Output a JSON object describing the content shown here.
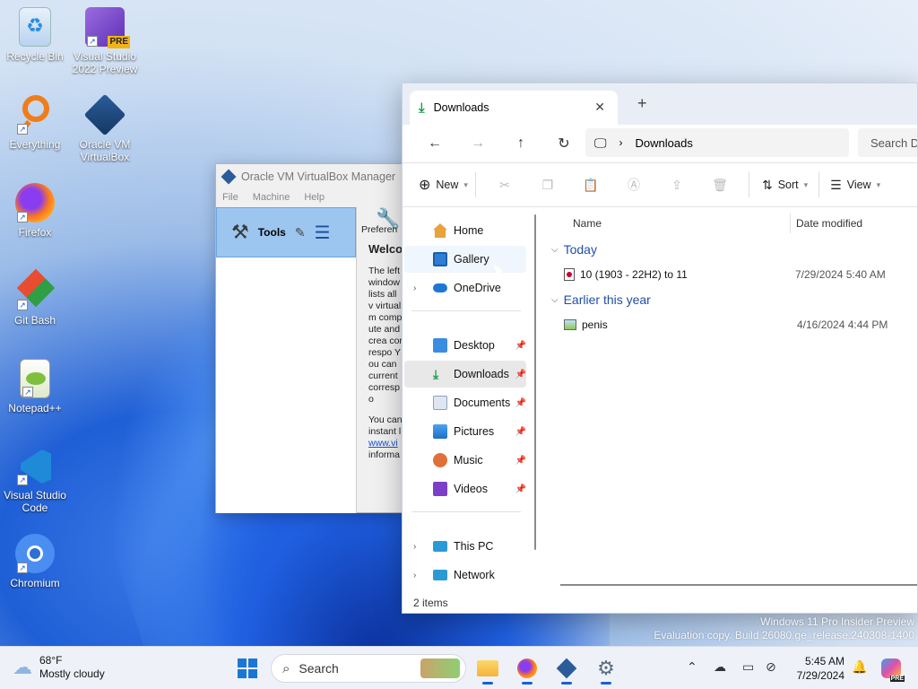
{
  "desktop": {
    "icons": [
      {
        "label": "Recycle Bin"
      },
      {
        "label": "Visual Studio 2022 Preview",
        "badge": "PRE"
      },
      {
        "label": "Everything"
      },
      {
        "label": "Oracle VM VirtualBox"
      },
      {
        "label": "Firefox"
      },
      {
        "label": "Git Bash"
      },
      {
        "label": "Notepad++"
      },
      {
        "label": "Visual Studio Code"
      },
      {
        "label": "Chromium"
      }
    ]
  },
  "vbox": {
    "title": "Oracle VM VirtualBox Manager",
    "menu": [
      "File",
      "Machine",
      "Help"
    ],
    "tools_label": "Tools",
    "preferences_label": "Preferen",
    "welcome_heading": "Welco",
    "welcome_text": "The left window lists all v virtual m compute and crea correspo You can current correspo",
    "welcome_text2": "You can instant l",
    "welcome_link": "www.vi",
    "welcome_text3": "informa"
  },
  "explorer": {
    "tab_title": "Downloads",
    "address": "Downloads",
    "search_placeholder": "Search D",
    "cmd": {
      "new": "New",
      "sort": "Sort",
      "view": "View"
    },
    "nav": {
      "home": "Home",
      "gallery": "Gallery",
      "onedrive": "OneDrive",
      "desktop": "Desktop",
      "downloads": "Downloads",
      "documents": "Documents",
      "pictures": "Pictures",
      "music": "Music",
      "videos": "Videos",
      "thispc": "This PC",
      "network": "Network"
    },
    "columns": {
      "name": "Name",
      "date": "Date modified"
    },
    "groups": [
      {
        "label": "Today",
        "files": [
          {
            "name": "10 (1903 - 22H2) to 11",
            "date": "7/29/2024 5:40 AM"
          }
        ]
      },
      {
        "label": "Earlier this year",
        "files": [
          {
            "name": "penis",
            "date": "4/16/2024 4:44 PM"
          }
        ]
      }
    ],
    "status": "2 items"
  },
  "watermark": {
    "line1": "Windows 11 Pro Insider Preview",
    "line2": "Evaluation copy. Build 26080.ge_release.240308-1400"
  },
  "taskbar": {
    "weather_temp": "68°F",
    "weather_desc": "Mostly cloudy",
    "search_placeholder": "Search",
    "time": "5:45 AM",
    "date": "7/29/2024",
    "copilot_badge": "PRE"
  },
  "colors": {
    "accent": "#1c5fd6",
    "selection": "#e8e8e8",
    "group_header": "#1f4fa8"
  }
}
